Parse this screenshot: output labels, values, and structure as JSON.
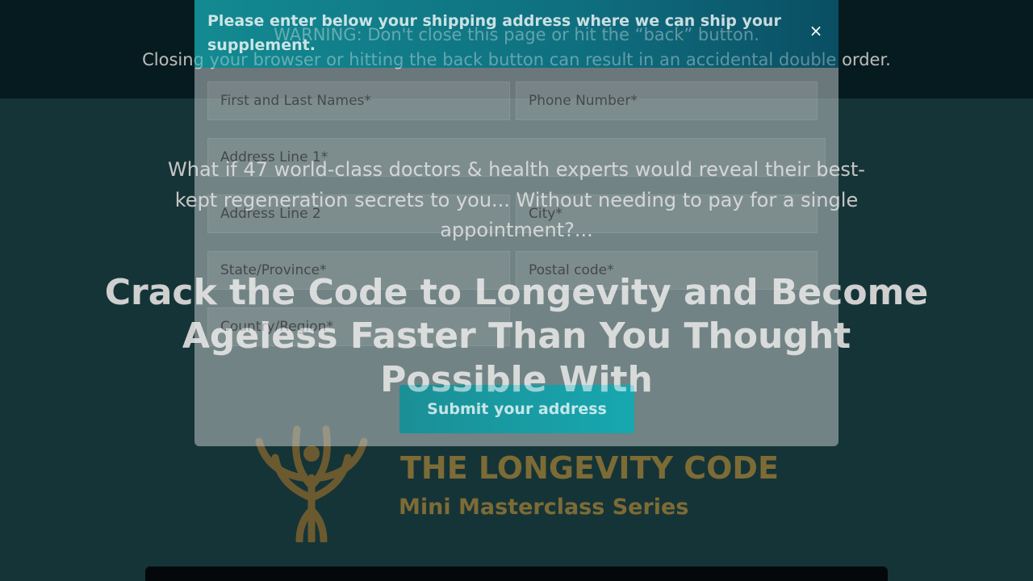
{
  "warning": {
    "label": "WARNING:",
    "message": " Don't close this page or hit the “back” button.",
    "line2": "Closing your browser or hitting the back button can result in an accidental double order."
  },
  "hero": {
    "intro": "What if 47 world-class doctors & health experts would reveal their best-kept regeneration secrets to you... Without needing to pay for a single appointment?...",
    "headline": "Crack the Code to Longevity and Become Ageless Faster Than You Thought Possible With"
  },
  "logo": {
    "title": "THE LONGEVITY CODE",
    "subtitle": "Mini Masterclass Series"
  },
  "modal": {
    "title": "Please enter below your shipping address where we can ship your supplement.",
    "close": "×",
    "fields": {
      "name": "First and Last Names*",
      "phone": "Phone Number*",
      "address1": "Address Line 1*",
      "address2": "Address Line 2",
      "city": "City*",
      "state": "State/Province*",
      "postal": "Postal code*",
      "country": "Country/Region*"
    },
    "submit": "Submit your address"
  },
  "colors": {
    "accent": "#18a7b0",
    "gold": "#d7b85e",
    "warning_bar": "#0c3036"
  }
}
